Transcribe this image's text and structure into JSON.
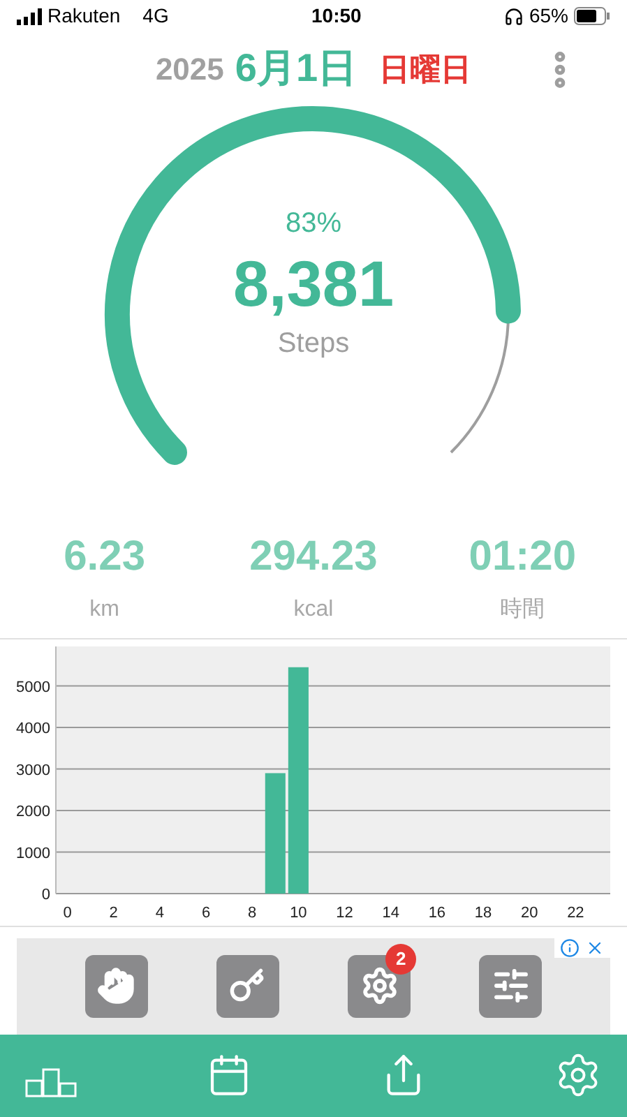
{
  "status_bar": {
    "carrier": "Rakuten",
    "network": "4G",
    "time": "10:50",
    "battery": "65%"
  },
  "header": {
    "year": "2025",
    "date": "6月1日",
    "weekday": "日曜日"
  },
  "gauge": {
    "percent": "83%",
    "steps": "8,381",
    "unit": "Steps"
  },
  "stats": [
    {
      "value": "6.23",
      "unit": "km"
    },
    {
      "value": "294.23",
      "unit": "kcal"
    },
    {
      "value": "01:20",
      "unit": "時間"
    }
  ],
  "chart_data": {
    "type": "bar",
    "x": [
      9,
      10
    ],
    "xlim": [
      -0.5,
      23.5
    ],
    "series": [
      {
        "color": "#43b897",
        "values": [
          2900,
          5450
        ]
      }
    ],
    "ylim": [
      0,
      5950
    ],
    "grid": true,
    "yticks": [
      0,
      1000,
      2000,
      3000,
      4000,
      5000
    ],
    "xticks": [
      0,
      2,
      4,
      6,
      8,
      10,
      12,
      14,
      16,
      18,
      20,
      22
    ]
  },
  "ad": {
    "badge": "2"
  },
  "nav": [
    {
      "kind": "ranking"
    },
    {
      "kind": "calendar"
    },
    {
      "kind": "share"
    },
    {
      "kind": "settings"
    }
  ]
}
